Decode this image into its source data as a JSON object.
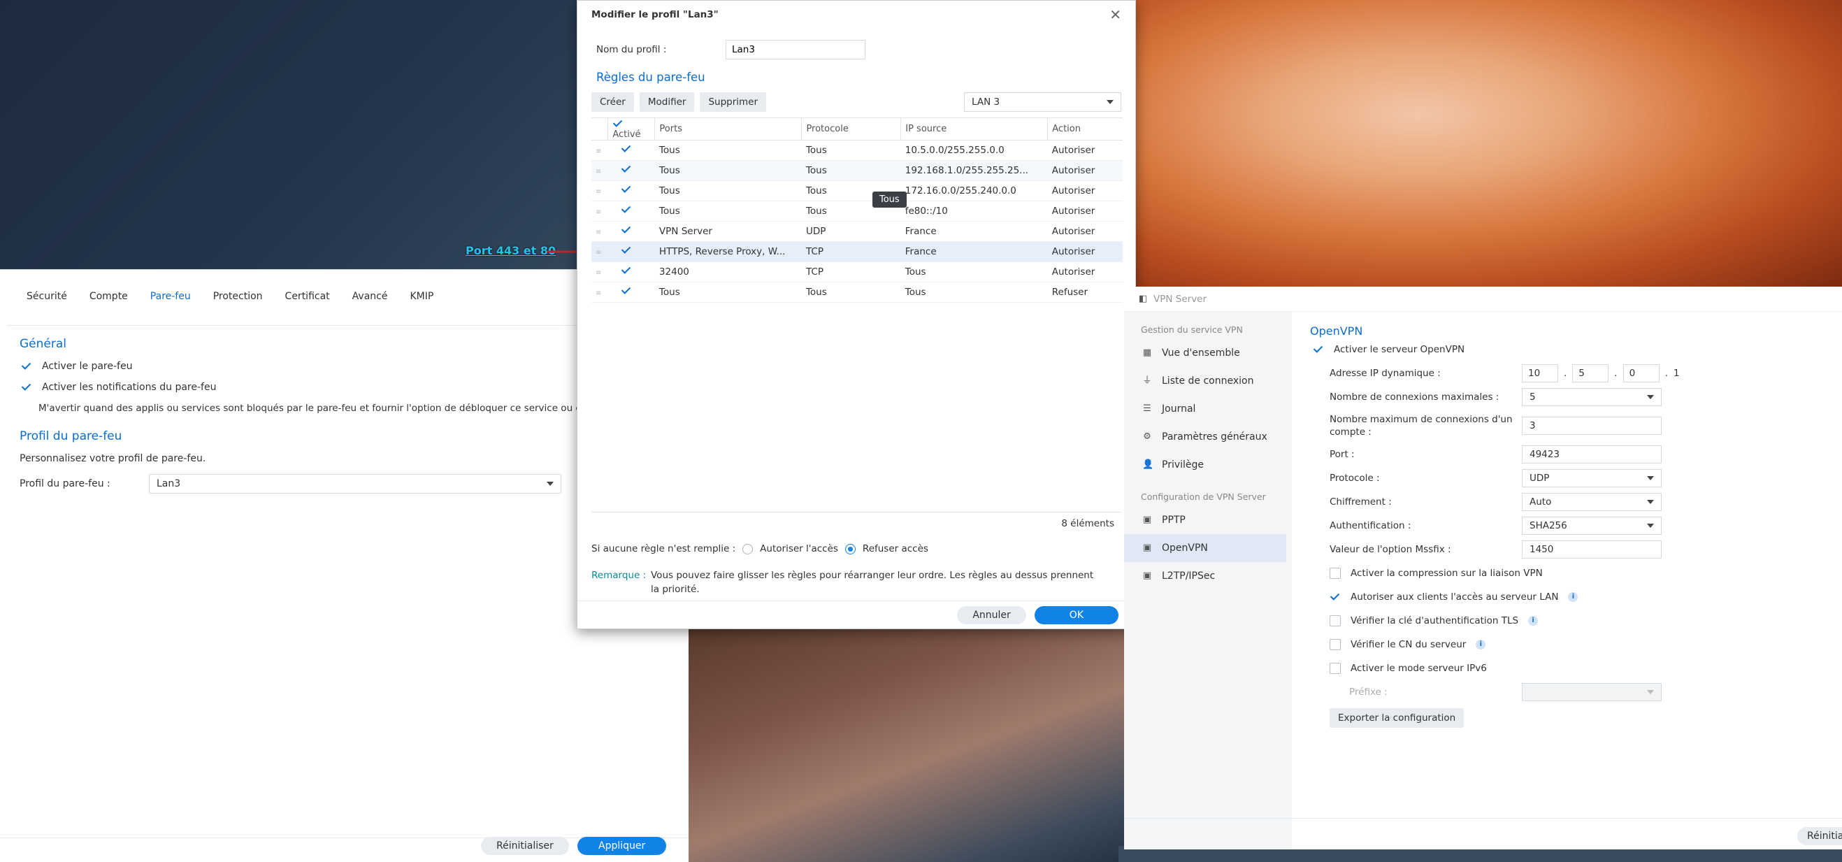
{
  "annotation": {
    "label": "Port 443 et 80"
  },
  "security": {
    "tabs": [
      "Sécurité",
      "Compte",
      "Pare-feu",
      "Protection",
      "Certificat",
      "Avancé",
      "KMIP"
    ],
    "general_heading": "Général",
    "enable_firewall": "Activer le pare-feu",
    "enable_notifications": "Activer les notifications du pare-feu",
    "notify_note": "M'avertir quand des applis ou services sont bloqués par le pare-feu et fournir l'option de débloquer ce service ou cett",
    "profile_heading": "Profil du pare-feu",
    "profile_desc": "Personnalisez votre profil de pare-feu.",
    "profile_label": "Profil du pare-feu :",
    "profile_value": "Lan3",
    "reset_label": "Réinitialiser",
    "apply_label": "Appliquer"
  },
  "modal": {
    "title": "Modifier le profil \"Lan3\"",
    "profile_name_label": "Nom du profil :",
    "profile_name_value": "Lan3",
    "rules_heading": "Règles du pare-feu",
    "toolbar": {
      "create": "Créer",
      "modify": "Modifier",
      "delete": "Supprimer"
    },
    "interface_select": "LAN 3",
    "columns": {
      "enabled": "Activé",
      "ports": "Ports",
      "protocol": "Protocole",
      "source": "IP source",
      "action": "Action"
    },
    "rules": [
      {
        "ports": "Tous",
        "protocol": "Tous",
        "source": "10.5.0.0/255.255.0.0",
        "action": "Autoriser"
      },
      {
        "ports": "Tous",
        "protocol": "Tous",
        "source": "192.168.1.0/255.255.25...",
        "action": "Autoriser"
      },
      {
        "ports": "Tous",
        "protocol": "Tous",
        "source": "172.16.0.0/255.240.0.0",
        "action": "Autoriser"
      },
      {
        "ports": "Tous",
        "protocol": "Tous",
        "source": "fe80::/10",
        "action": "Autoriser"
      },
      {
        "ports": "VPN Server",
        "protocol": "UDP",
        "source": "France",
        "action": "Autoriser"
      },
      {
        "ports": "HTTPS, Reverse Proxy, W...",
        "protocol": "TCP",
        "source": "France",
        "action": "Autoriser"
      },
      {
        "ports": "32400",
        "protocol": "TCP",
        "source": "Tous",
        "action": "Autoriser"
      },
      {
        "ports": "Tous",
        "protocol": "Tous",
        "source": "Tous",
        "action": "Refuser"
      }
    ],
    "tooltip": "Tous",
    "count": "8 éléments",
    "no_rule_label": "Si aucune règle n'est remplie :",
    "allow_access": "Autoriser l'accès",
    "deny_access": "Refuser accès",
    "remark_label": "Remarque :",
    "remark_text": "Vous pouvez faire glisser les règles pour réarranger leur ordre. Les règles au dessus prennent la priorité.",
    "cancel_label": "Annuler",
    "ok_label": "OK"
  },
  "vpn": {
    "window_title": "VPN Server",
    "section_service": "Gestion du service VPN",
    "nav_service": [
      "Vue d'ensemble",
      "Liste de connexion",
      "Journal",
      "Paramètres généraux",
      "Privilège"
    ],
    "section_config": "Configuration de VPN Server",
    "nav_config": [
      "PPTP",
      "OpenVPN",
      "L2TP/IPSec"
    ],
    "heading": "OpenVPN",
    "enable_server": "Activer le serveur OpenVPN",
    "dynamic_ip_label": "Adresse IP dynamique :",
    "ip": [
      "10",
      "5",
      "0",
      "1"
    ],
    "max_conn_label": "Nombre de connexions maximales :",
    "max_conn_value": "5",
    "max_account_label": "Nombre maximum de connexions d'un compte :",
    "max_account_value": "3",
    "port_label": "Port :",
    "port_value": "49423",
    "protocol_label": "Protocole :",
    "protocol_value": "UDP",
    "encryption_label": "Chiffrement :",
    "encryption_value": "Auto",
    "auth_label": "Authentification :",
    "auth_value": "SHA256",
    "mssfix_label": "Valeur de l'option Mssfix :",
    "mssfix_value": "1450",
    "opt_compression": "Activer la compression sur la liaison VPN",
    "opt_lan": "Autoriser aux clients l'accès au serveur LAN",
    "opt_tls": "Vérifier la clé d'authentification TLS",
    "opt_cn": "Vérifier le CN du serveur",
    "opt_ipv6": "Activer le mode serveur IPv6",
    "prefix_label": "Préfixe :",
    "export_label": "Exporter la configuration",
    "reset_label": "Réinitia"
  }
}
